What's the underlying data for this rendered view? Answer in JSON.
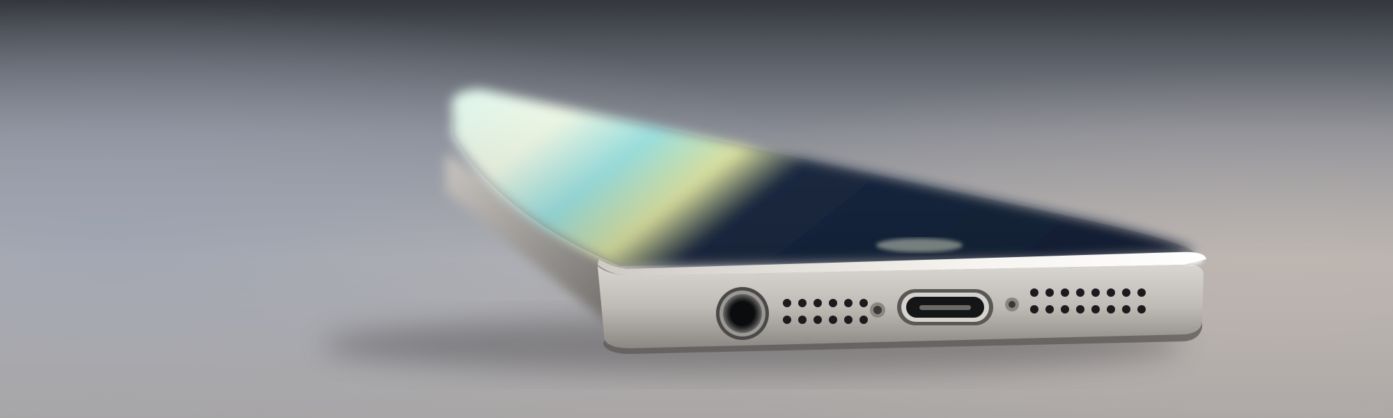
{
  "image": {
    "subject": "smartphone",
    "colors": {
      "wall_top": "#34373d",
      "wall_mid": "#5b5f67",
      "table_far": "#8a8d95",
      "table_mid": "#b7b5b4",
      "table_near": "#a9a6a5",
      "table_cool_left": "#9aa1b2",
      "metal_light": "#e9e7e4",
      "metal_mid": "#bfbbb6",
      "metal_dark": "#6f6c69",
      "screen_glare": "#f2fbe8",
      "screen_cyan": "#9fe7e6",
      "screen_yellow": "#e7eda8",
      "screen_dark": "#1b2a44",
      "port_dark": "#111214"
    },
    "icons": [
      "headphone-jack-icon",
      "speaker-grille-icon",
      "lightning-port-icon",
      "microphone-hole-icon",
      "screw-icon"
    ]
  }
}
